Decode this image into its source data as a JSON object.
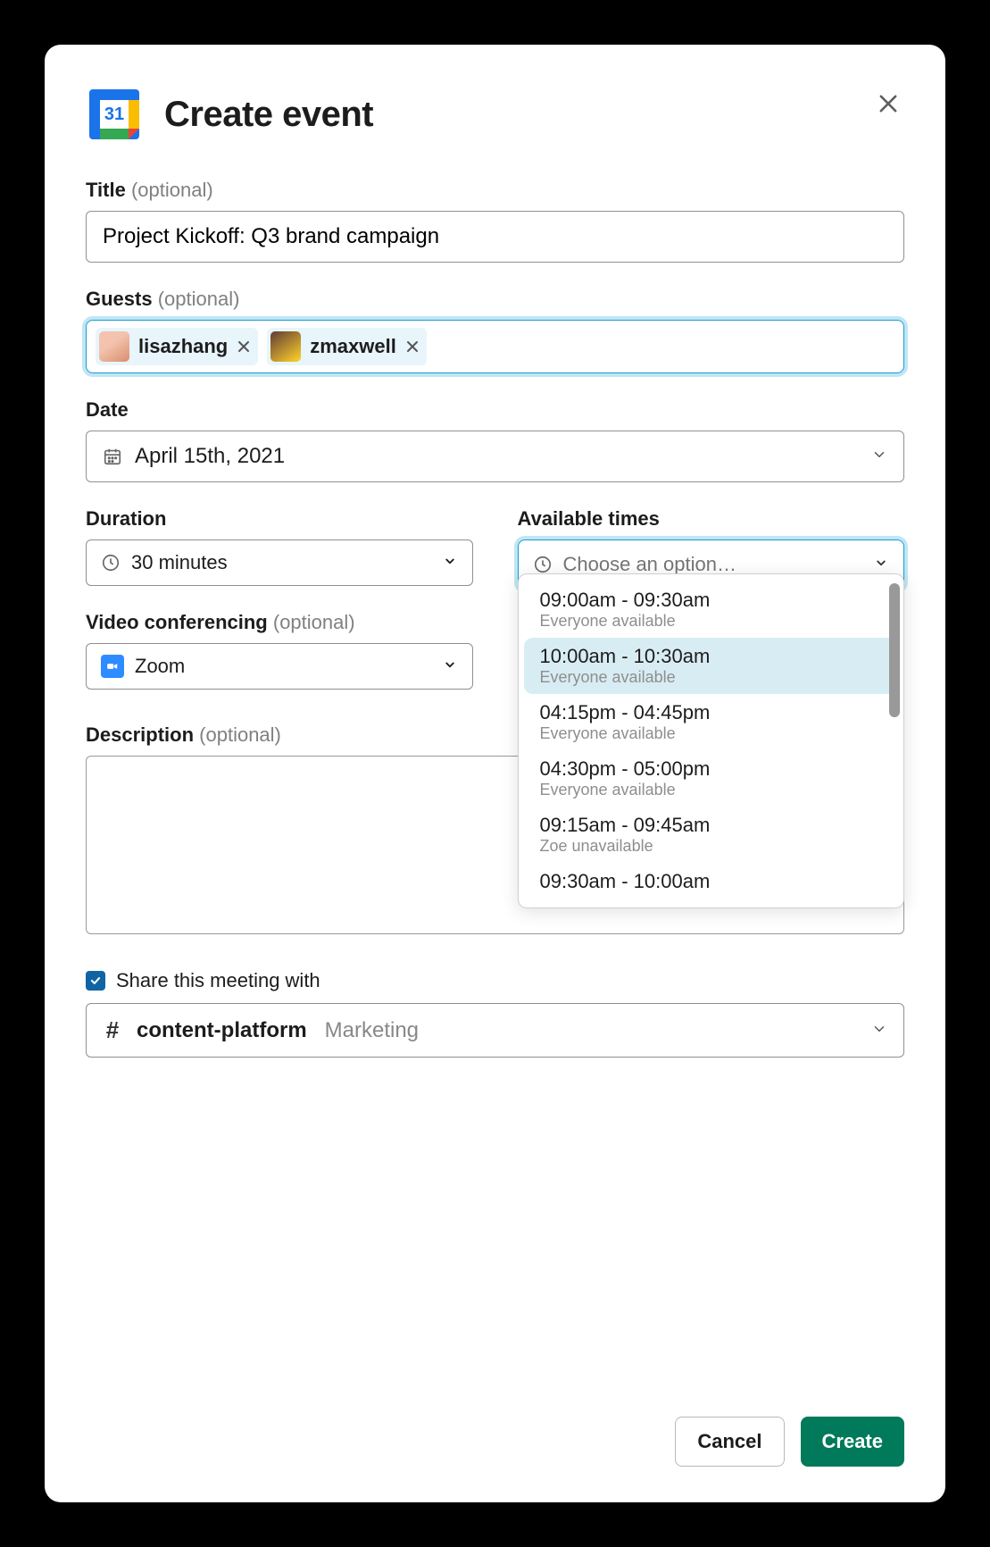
{
  "header": {
    "title": "Create event"
  },
  "title_field": {
    "label": "Title",
    "optional": "(optional)",
    "value": "Project Kickoff: Q3 brand campaign"
  },
  "guests": {
    "label": "Guests",
    "optional": "(optional)",
    "chips": [
      {
        "name": "lisazhang"
      },
      {
        "name": "zmaxwell"
      }
    ]
  },
  "date": {
    "label": "Date",
    "value": "April 15th, 2021"
  },
  "duration": {
    "label": "Duration",
    "value": "30 minutes"
  },
  "available": {
    "label": "Available times",
    "placeholder": "Choose an option…",
    "options": [
      {
        "time": "09:00am - 09:30am",
        "sub": "Everyone available",
        "selected": false
      },
      {
        "time": "10:00am - 10:30am",
        "sub": "Everyone available",
        "selected": true
      },
      {
        "time": "04:15pm - 04:45pm",
        "sub": "Everyone available",
        "selected": false
      },
      {
        "time": "04:30pm - 05:00pm",
        "sub": "Everyone available",
        "selected": false
      },
      {
        "time": "09:15am - 09:45am",
        "sub": "Zoe unavailable",
        "selected": false
      },
      {
        "time": "09:30am - 10:00am",
        "sub": "",
        "selected": false
      }
    ]
  },
  "video": {
    "label": "Video conferencing",
    "optional": "(optional)",
    "value": "Zoom"
  },
  "description": {
    "label": "Description",
    "optional": "(optional)",
    "value": ""
  },
  "share": {
    "checkbox_label": "Share this meeting with",
    "checked": true,
    "channel_name": "content-platform",
    "channel_desc": "Marketing"
  },
  "footer": {
    "cancel": "Cancel",
    "create": "Create"
  }
}
